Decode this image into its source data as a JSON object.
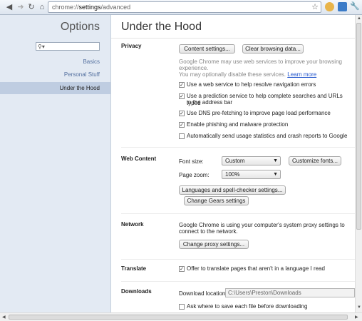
{
  "browser": {
    "url_scheme": "chrome://",
    "url_host": "settings",
    "url_path": "/advanced",
    "icons": [
      "back-icon",
      "forward-icon",
      "reload-icon",
      "home-icon",
      "star-icon",
      "extension-icon",
      "page-menu-icon",
      "wrench-icon"
    ]
  },
  "sidebar": {
    "title": "Options",
    "search_placeholder": "",
    "items": [
      {
        "label": "Basics"
      },
      {
        "label": "Personal Stuff"
      },
      {
        "label": "Under the Hood",
        "selected": true
      }
    ]
  },
  "main": {
    "title": "Under the Hood",
    "privacy": {
      "label": "Privacy",
      "content_settings_button": "Content settings...",
      "clear_browsing_button": "Clear browsing data...",
      "info_line1": "Google Chrome may use web services to improve your browsing",
      "info_line2": "experience.",
      "info_line3": "You may optionally disable these services.",
      "learn_more": "Learn more",
      "options": [
        {
          "label": "Use a web service to help resolve navigation errors",
          "checked": true
        },
        {
          "label_line1": "Use a prediction service to help complete searches and URLs typed",
          "label_line2": "in the address bar",
          "checked": true
        },
        {
          "label": "Use DNS pre-fetching to improve page load performance",
          "checked": true
        },
        {
          "label": "Enable phishing and malware protection",
          "checked": true
        },
        {
          "label": "Automatically send usage statistics and crash reports to Google",
          "checked": false
        }
      ]
    },
    "web_content": {
      "label": "Web Content",
      "font_size_label": "Font size:",
      "font_size_value": "Custom",
      "customize_fonts_button": "Customize fonts...",
      "page_zoom_label": "Page zoom:",
      "page_zoom_value": "100%",
      "languages_button": "Languages and spell-checker settings...",
      "gears_button": "Change Gears settings"
    },
    "network": {
      "label": "Network",
      "info_line1": "Google Chrome is using your computer's system proxy settings to",
      "info_line2": "connect to the network.",
      "proxy_button": "Change proxy settings..."
    },
    "translate": {
      "label": "Translate",
      "option": "Offer to translate pages that aren't in a language I read",
      "checked": true
    },
    "downloads": {
      "label": "Downloads",
      "location_label": "Download location:",
      "location_value": "C:\\Users\\Preston\\Downloads",
      "ask_option": "Ask where to save each file before downloading",
      "ask_checked": false
    }
  },
  "colors": {
    "sidebar_bg": "#e3eaf3",
    "sidebar_selected": "#bfcde1",
    "link": "#2255cc"
  }
}
